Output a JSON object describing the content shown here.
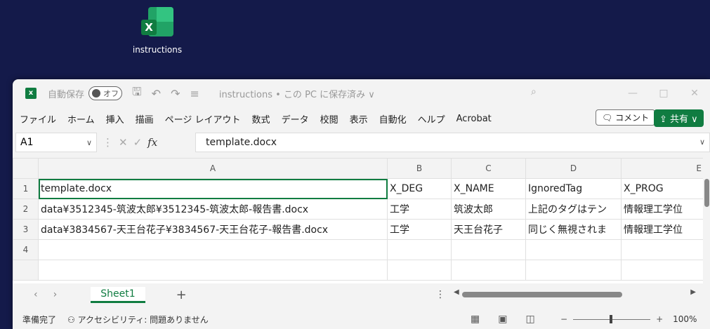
{
  "desktop": {
    "icon_label": "instructions"
  },
  "titlebar": {
    "autosave_label": "自動保存",
    "autosave_state": "オフ",
    "doc_title": "instructions • この PC に保存済み ∨"
  },
  "menu": {
    "items": [
      "ファイル",
      "ホーム",
      "挿入",
      "描画",
      "ページ レイアウト",
      "数式",
      "データ",
      "校閲",
      "表示",
      "自動化",
      "ヘルプ",
      "Acrobat"
    ],
    "comment_label": "コメント",
    "share_label": "共有"
  },
  "formula_bar": {
    "namebox": "A1",
    "content": "template.docx"
  },
  "grid": {
    "columns": [
      "A",
      "B",
      "C",
      "D",
      "E"
    ],
    "rows": [
      {
        "num": "1",
        "cells": [
          "template.docx",
          "X_DEG",
          "X_NAME",
          "IgnoredTag",
          "X_PROG"
        ]
      },
      {
        "num": "2",
        "cells": [
          "data¥3512345-筑波太郎¥3512345-筑波太郎-報告書.docx",
          "工学",
          "筑波太郎",
          "上記のタグはテン",
          "情報理工学位"
        ]
      },
      {
        "num": "3",
        "cells": [
          "data¥3834567-天王台花子¥3834567-天王台花子-報告書.docx",
          "工学",
          "天王台花子",
          "同じく無視されま",
          "情報理工学位"
        ]
      },
      {
        "num": "4",
        "cells": [
          "",
          "",
          "",
          "",
          ""
        ]
      }
    ]
  },
  "sheets": {
    "active": "Sheet1"
  },
  "status": {
    "ready": "準備完了",
    "accessibility": "アクセシビリティ: 問題ありません",
    "zoom": "100%"
  },
  "colors": {
    "accent": "#107c41",
    "desktop": "#141a4a"
  }
}
